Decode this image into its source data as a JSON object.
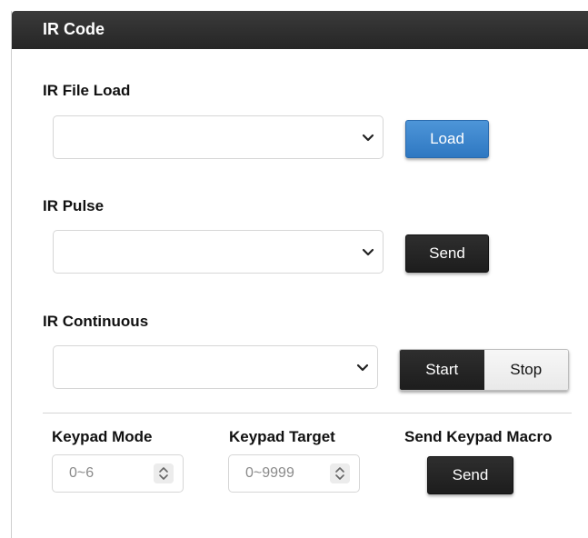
{
  "panel": {
    "title": "IR Code"
  },
  "file_load": {
    "label": "IR File Load",
    "select_value": "",
    "button_label": "Load"
  },
  "pulse": {
    "label": "IR Pulse",
    "select_value": "",
    "button_label": "Send"
  },
  "continuous": {
    "label": "IR Continuous",
    "select_value": "",
    "start_label": "Start",
    "stop_label": "Stop",
    "active": "Start"
  },
  "keypad": {
    "mode_label": "Keypad Mode",
    "mode_placeholder": "0~6",
    "target_label": "Keypad Target",
    "target_placeholder": "0~9999",
    "macro_label": "Send Keypad Macro",
    "macro_button_label": "Send"
  },
  "colors": {
    "header": "#262626",
    "primary": "#3a86cf",
    "dark_button": "#242424"
  },
  "icons": {
    "dropdown": "chevron-down-icon",
    "spinner": "spinner-arrows-icon"
  }
}
